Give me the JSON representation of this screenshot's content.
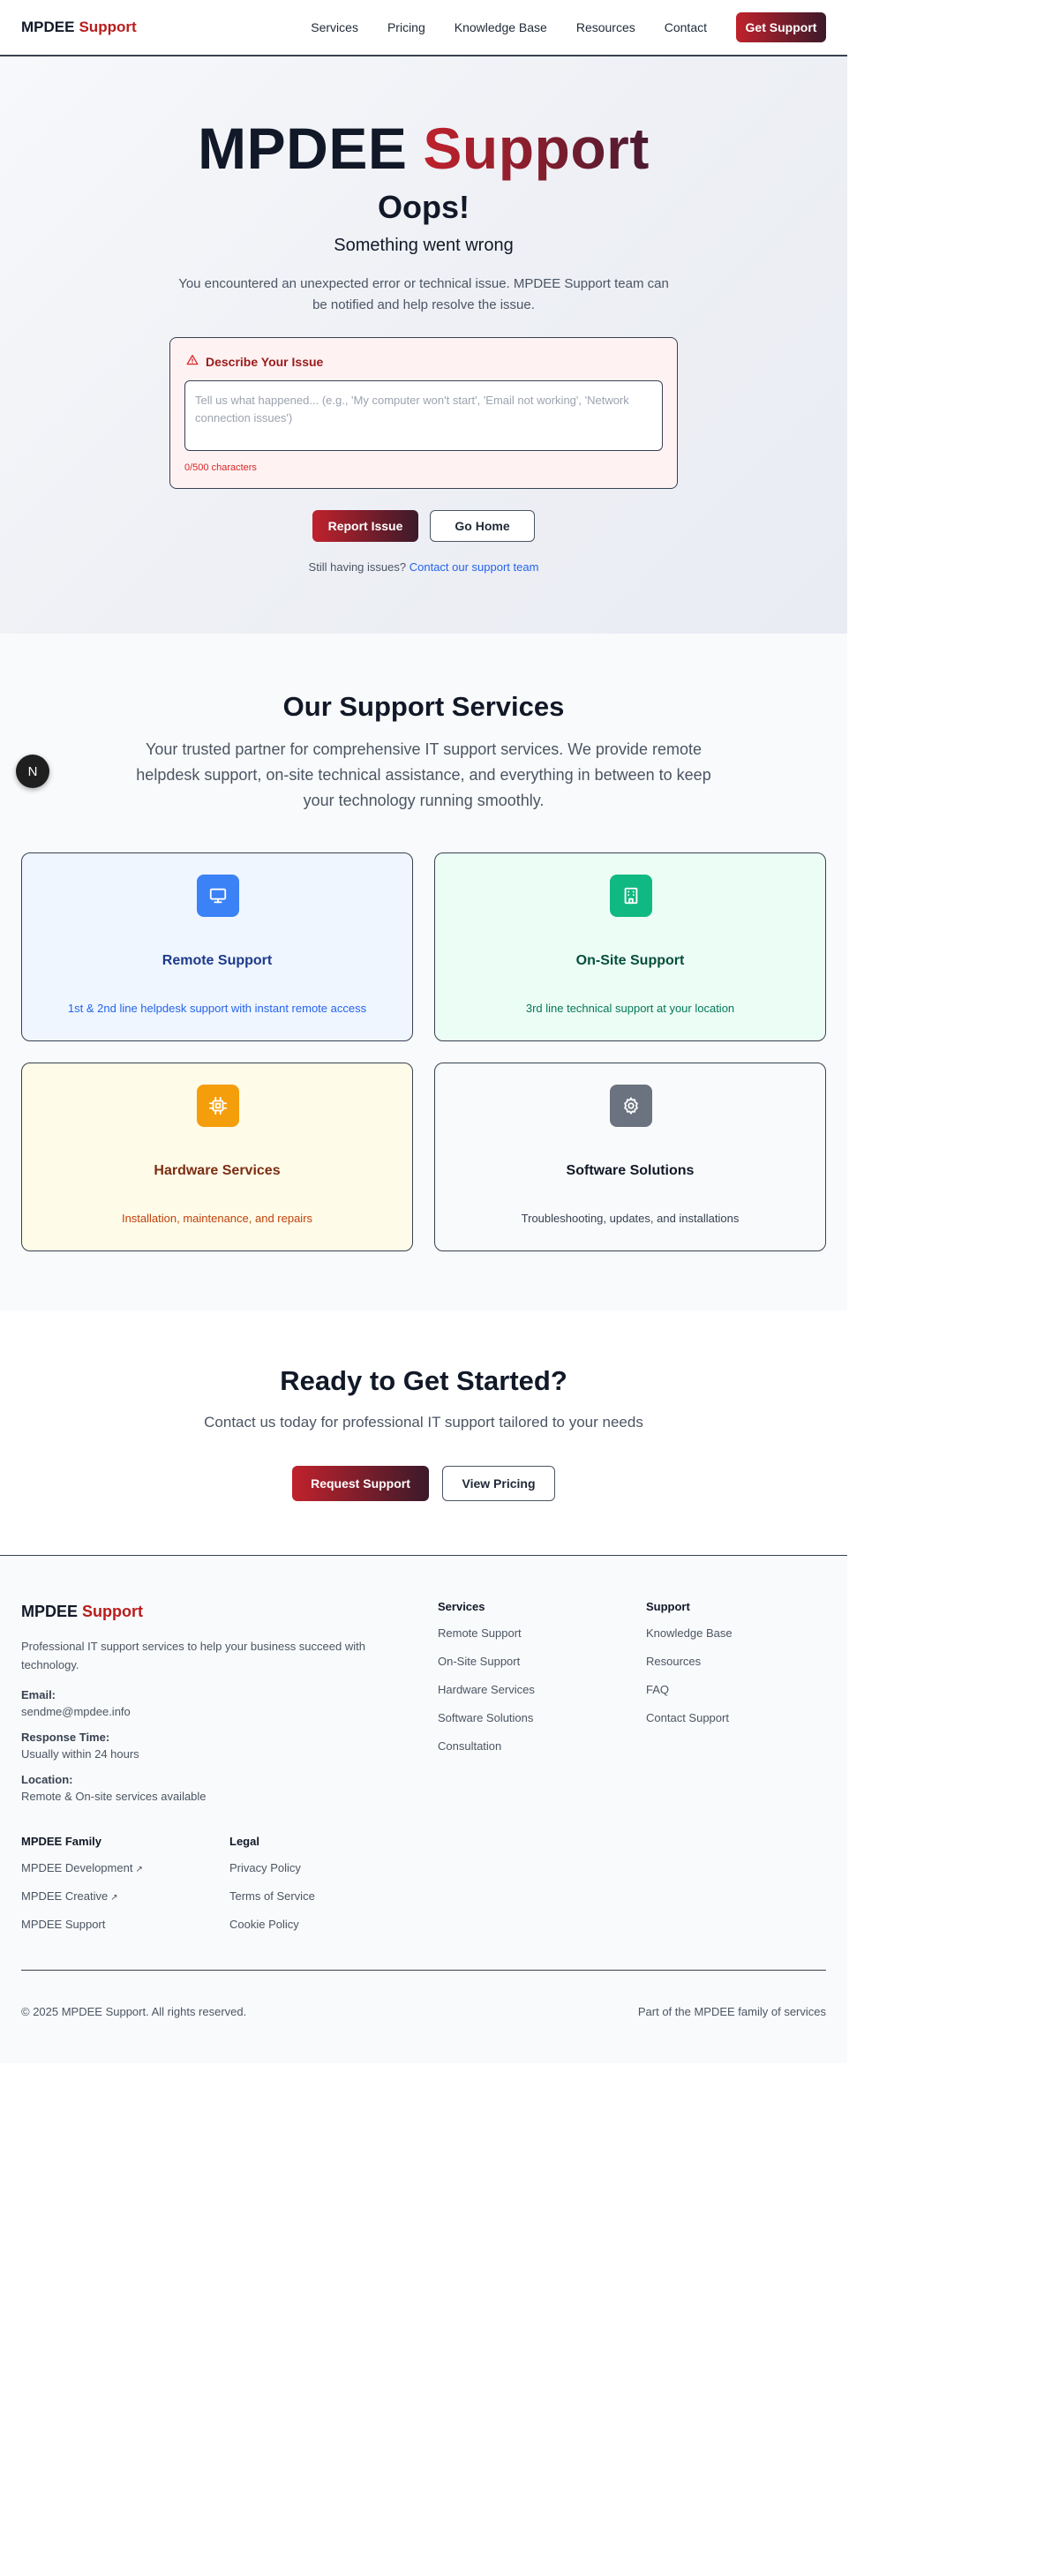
{
  "header": {
    "brand_main": "MPDEE",
    "brand_accent": "Support",
    "nav": [
      "Services",
      "Pricing",
      "Knowledge Base",
      "Resources",
      "Contact"
    ],
    "cta_label": "Get Support"
  },
  "hero": {
    "title_main": "MPDEE",
    "title_accent": "Support",
    "oops": "Oops!",
    "subtitle": "Something went wrong",
    "description": "You encountered an unexpected error or technical issue. MPDEE Support team can be notified and help resolve the issue.",
    "issue": {
      "heading": "Describe Your Issue",
      "placeholder": "Tell us what happened... (e.g., 'My computer won't start', 'Email not working', 'Network connection issues')",
      "char_count": "0/500 characters"
    },
    "report_label": "Report Issue",
    "home_label": "Go Home",
    "still_text": "Still having issues?",
    "contact_link": "Contact our support team"
  },
  "services": {
    "title": "Our Support Services",
    "description": "Your trusted partner for comprehensive IT support services. We provide remote helpdesk support, on-site technical assistance, and everything in between to keep your technology running smoothly.",
    "cards": [
      {
        "title": "Remote Support",
        "desc": "1st & 2nd line helpdesk support with instant remote access",
        "icon": "monitor-icon"
      },
      {
        "title": "On-Site Support",
        "desc": "3rd line technical support at your location",
        "icon": "building-icon"
      },
      {
        "title": "Hardware Services",
        "desc": "Installation, maintenance, and repairs",
        "icon": "chip-icon"
      },
      {
        "title": "Software Solutions",
        "desc": "Troubleshooting, updates, and installations",
        "icon": "gear-icon"
      }
    ]
  },
  "floating": {
    "label": "N"
  },
  "cta": {
    "title": "Ready to Get Started?",
    "description": "Contact us today for professional IT support tailored to your needs",
    "primary_label": "Request Support",
    "secondary_label": "View Pricing"
  },
  "footer": {
    "brand_main": "MPDEE",
    "brand_accent": "Support",
    "description": "Professional IT support services to help your business succeed with technology.",
    "email_label": "Email:",
    "email_value": "sendme@mpdee.info",
    "response_label": "Response Time:",
    "response_value": "Usually within 24 hours",
    "location_label": "Location:",
    "location_value": "Remote & On-site services available",
    "services_heading": "Services",
    "services_links": [
      "Remote Support",
      "On-Site Support",
      "Hardware Services",
      "Software Solutions",
      "Consultation"
    ],
    "support_heading": "Support",
    "support_links": [
      "Knowledge Base",
      "Resources",
      "FAQ",
      "Contact Support"
    ],
    "family_heading": "MPDEE Family",
    "family_links": [
      "MPDEE Development",
      "MPDEE Creative",
      "MPDEE Support"
    ],
    "legal_heading": "Legal",
    "legal_links": [
      "Privacy Policy",
      "Terms of Service",
      "Cookie Policy"
    ],
    "copyright": "© 2025 MPDEE Support. All rights reserved.",
    "family_note": "Part of the MPDEE family of services"
  },
  "colors": {
    "accent": "#b91c1c",
    "link": "#2563eb",
    "remote": "#3b82f6",
    "onsite": "#10b981",
    "hardware": "#f59e0b",
    "software": "#6b7280"
  }
}
